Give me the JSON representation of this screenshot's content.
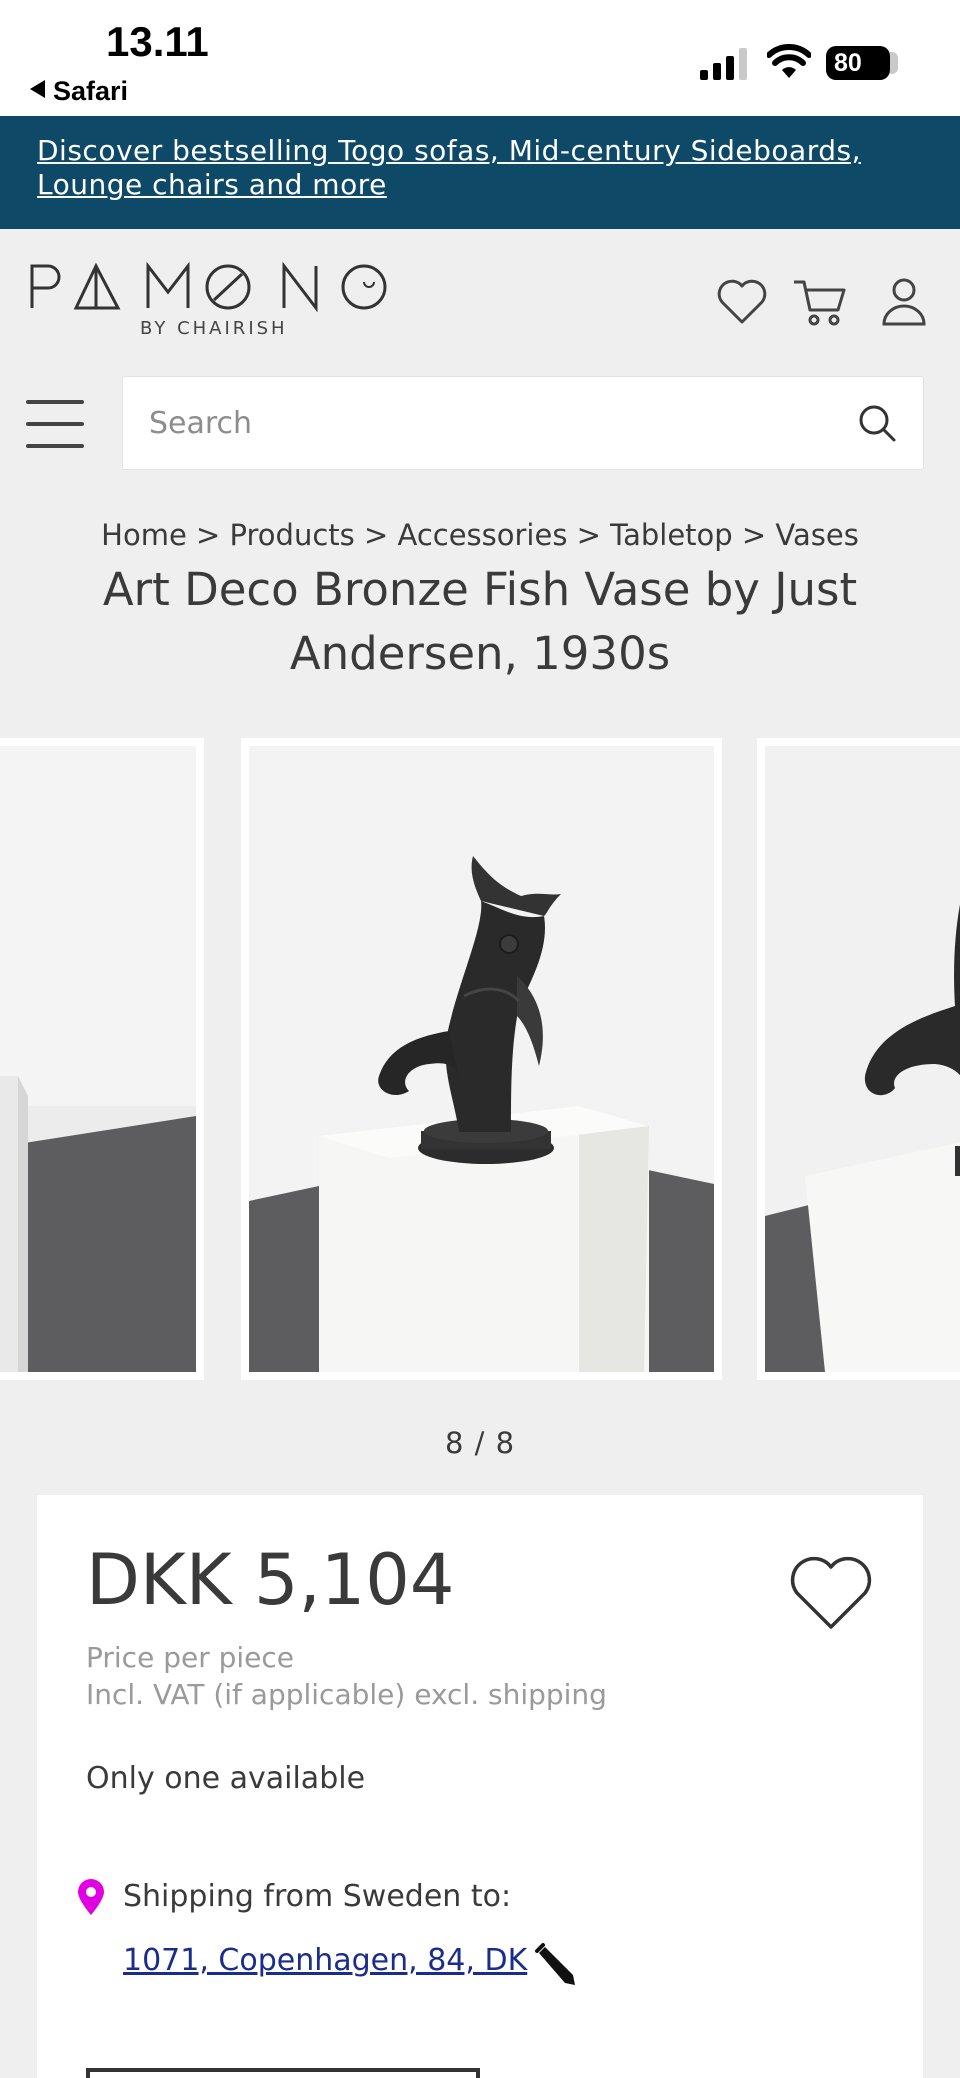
{
  "status_bar": {
    "time": "13.11",
    "back_app": "Safari",
    "battery": "80",
    "icons": [
      "signal-icon",
      "wifi-icon",
      "battery-icon"
    ]
  },
  "promo": {
    "text": "Discover bestselling Togo sofas, Mid-century Sideboards, Lounge chairs and more"
  },
  "header": {
    "logo": "PAMONO",
    "logo_sub": "BY CHAIRISH",
    "icons": [
      "heart-icon",
      "cart-icon",
      "user-icon"
    ]
  },
  "search": {
    "placeholder": "Search"
  },
  "breadcrumb": "Home > Products > Accessories > Tabletop > Vases",
  "product": {
    "title": "Art Deco Bronze Fish Vase by Just Andersen, 1930s",
    "gallery": {
      "pager": "8 / 8",
      "current": 8,
      "total": 8
    },
    "price": "DKK 5,104",
    "price_note_1": "Price per piece",
    "price_note_2": "Incl. VAT (if applicable) excl. shipping",
    "availability": "Only one available",
    "shipping_label": "Shipping from Sweden to:",
    "shipping_address": "1071, Copenhagen, 84, DK"
  },
  "colors": {
    "banner": "#0e4a67",
    "page_bg": "#efefef",
    "pin": "#e100e1",
    "link": "#1a2d8c"
  }
}
